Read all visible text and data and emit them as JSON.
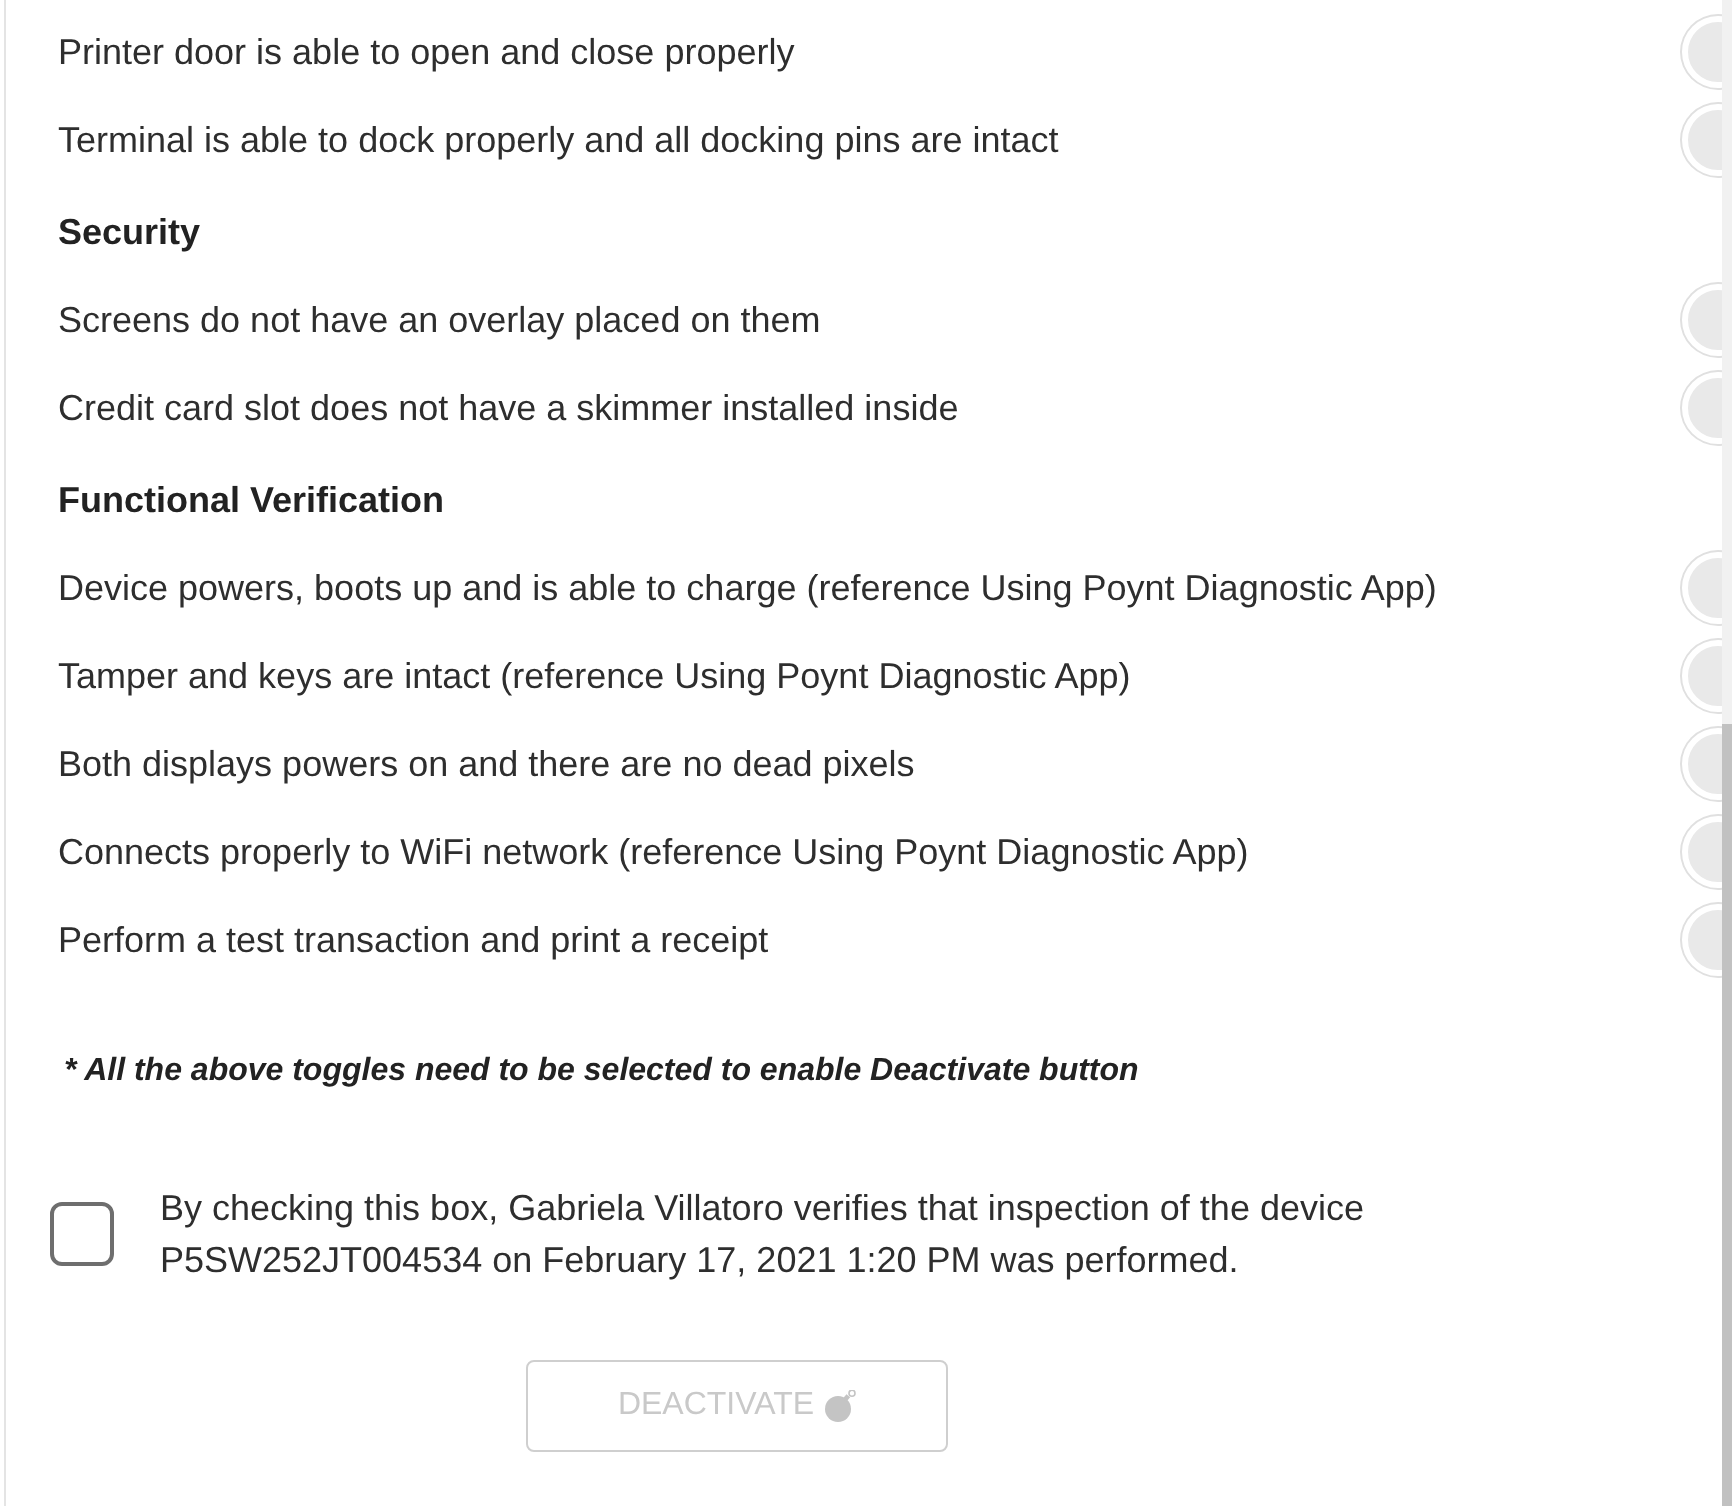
{
  "checklist": {
    "sections": [
      {
        "items": [
          {
            "label": "Printer door is able to open and close properly",
            "on": false
          },
          {
            "label": "Terminal is able to dock properly and all docking pins are intact",
            "on": false
          }
        ]
      },
      {
        "title": "Security",
        "items": [
          {
            "label": "Screens do not have an overlay placed on them",
            "on": false
          },
          {
            "label": "Credit card slot does not have a skimmer installed inside",
            "on": false
          }
        ]
      },
      {
        "title": "Functional Verification",
        "items": [
          {
            "label": "Device powers, boots up and is able to charge (reference Using Poynt Diagnostic App)",
            "on": false
          },
          {
            "label": "Tamper and keys are intact (reference Using Poynt Diagnostic App)",
            "on": false
          },
          {
            "label": "Both displays powers on and there are no dead pixels",
            "on": false
          },
          {
            "label": "Connects properly to WiFi network (reference Using Poynt Diagnostic App)",
            "on": false
          },
          {
            "label": "Perform a test transaction and print a receipt",
            "on": false
          }
        ]
      }
    ]
  },
  "note": "* All the above toggles need to be selected to enable Deactivate button",
  "confirmation": {
    "checked": false,
    "text": "By checking this box, Gabriela Villatoro verifies that inspection of the device P5SW252JT004534 on February 17, 2021 1:20 PM was performed."
  },
  "deactivate_button": {
    "label": "DEACTIVATE",
    "disabled": true
  }
}
